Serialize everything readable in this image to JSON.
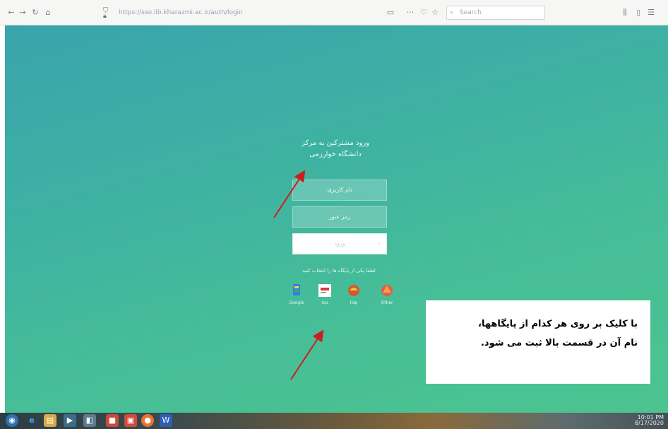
{
  "browser": {
    "nav": {
      "back": "←",
      "forward": "→",
      "reload": "↻",
      "home": "⌂"
    },
    "url": "https://sso.lib.kharazmi.ac.ir/auth/login",
    "search_placeholder": "Search",
    "page_actions": {
      "reader": "▭",
      "more": "···",
      "pocket": "♡",
      "bookmark": "☆"
    },
    "toolbar_right": {
      "library": "⫼",
      "sidebar": "▯",
      "account": "☰"
    }
  },
  "login": {
    "title_line1": "ورود مشترکین به مرکز",
    "title_line2": "دانشگاه خوارزمی",
    "username_placeholder": "نام کاربری",
    "password_placeholder": "رمز عبور",
    "submit_label": "ورود",
    "submit_chevron": "›",
    "choose_portal_label": "لطفا یکی از پایگاه ها را انتخاب کنید",
    "portals": [
      {
        "name": "Google",
        "color": "#1a73e8"
      },
      {
        "name": "Ivp",
        "color": "#d83838"
      },
      {
        "name": "Ilsp",
        "color": "#d35a2a"
      },
      {
        "name": "Other",
        "color": "#f08a3a"
      }
    ]
  },
  "annotation": {
    "line1": "با کلیک بر روی هر کدام از پایگاهها،",
    "line2": "نام آن در قسمت بالا ثبت می شود."
  },
  "taskbar": {
    "tray_time": "10:01 PM",
    "tray_date": "8/17/2020"
  },
  "colors": {
    "page_gradient_start": "#3aa4ac",
    "page_gradient_end": "#4cc48f",
    "arrow": "#cc1e1e"
  }
}
